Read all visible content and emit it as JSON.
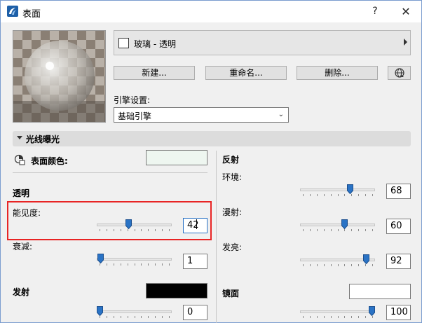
{
  "window": {
    "title": "表面",
    "help_label": "?",
    "close_label": "✕"
  },
  "material": {
    "name": "玻璃 - 透明"
  },
  "buttons": {
    "new": "新建...",
    "rename": "重命名...",
    "delete": "删除..."
  },
  "engine": {
    "label": "引擎设置:",
    "value": "基础引擎"
  },
  "section": {
    "title": "光线曝光"
  },
  "left": {
    "surface_color_label": "表面颜色:",
    "surface_color": "#eef6f0",
    "transparency_title": "透明",
    "visibility_label": "能见度:",
    "visibility_value": "42",
    "visibility_level": 42,
    "attenuation_label": "衰减:",
    "attenuation_value": "1",
    "attenuation_level": 1,
    "emission_title": "发射",
    "emission_color": "#000000",
    "emission_value": "0",
    "emission_level": 0
  },
  "right": {
    "reflection_title": "反射",
    "ambient_label": "环境:",
    "ambient_value": "68",
    "ambient_level": 68,
    "diffuse_label": "漫射:",
    "diffuse_value": "60",
    "diffuse_level": 60,
    "shine_label": "发亮:",
    "shine_value": "92",
    "shine_level": 92,
    "specular_title": "镜面",
    "specular_color": "#ffffff",
    "specular_value": "100",
    "specular_level": 100
  },
  "colors": {
    "accent": "#2a73c5",
    "highlight_box": "#e82424"
  }
}
